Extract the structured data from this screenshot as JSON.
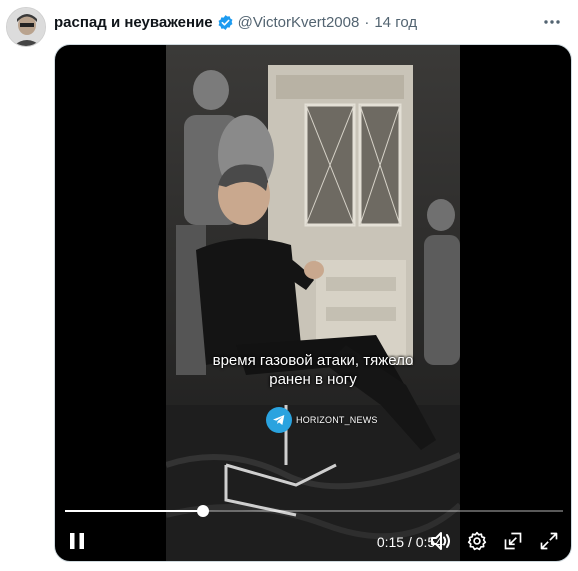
{
  "tweet": {
    "display_name": "распад и неуважение",
    "handle": "@VictorKvert2008",
    "separator": "·",
    "time": "14 год"
  },
  "video": {
    "subtitle_line1": "время газовой атаки, тяжело",
    "subtitle_line2": "ранен в ногу",
    "watermark": "HORIZONT_NEWS"
  },
  "player": {
    "current_time": "0:15",
    "time_separator": "/",
    "duration": "0:54",
    "progress_fraction": 0.278
  },
  "colors": {
    "verified": "#1d9bf0",
    "telegram": "#2aa3df"
  },
  "icons": [
    "verified-badge-icon",
    "more-icon",
    "pause-icon",
    "volume-icon",
    "settings-icon",
    "picture-in-picture-icon",
    "fullscreen-icon",
    "telegram-icon"
  ]
}
